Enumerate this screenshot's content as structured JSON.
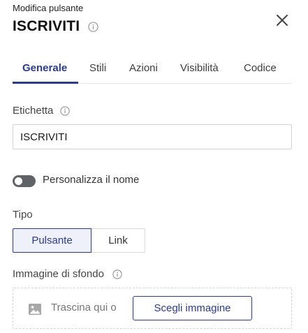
{
  "header": {
    "subtitle": "Modifica pulsante",
    "title": "ISCRIVITI"
  },
  "tabs": [
    {
      "label": "Generale",
      "active": true
    },
    {
      "label": "Stili",
      "active": false
    },
    {
      "label": "Azioni",
      "active": false
    },
    {
      "label": "Visibilità",
      "active": false
    },
    {
      "label": "Codice",
      "active": false
    }
  ],
  "fields": {
    "label_caption": "Etichetta",
    "label_value": "ISCRIVITI",
    "customize_name": "Personalizza il nome",
    "customize_name_enabled": false,
    "type_caption": "Tipo",
    "type_options": [
      "Pulsante",
      "Link"
    ],
    "type_selected": "Pulsante",
    "background_caption": "Immagine di sfondo",
    "drop_text": "Trascina qui o",
    "choose_button": "Scegli immagine"
  },
  "icons": {
    "info": "info-icon",
    "close": "close-icon",
    "image": "image-icon"
  },
  "colors": {
    "accent": "#2b3a8c",
    "toggle_off": "#5f6368",
    "selected_bg": "#eef1fa"
  }
}
